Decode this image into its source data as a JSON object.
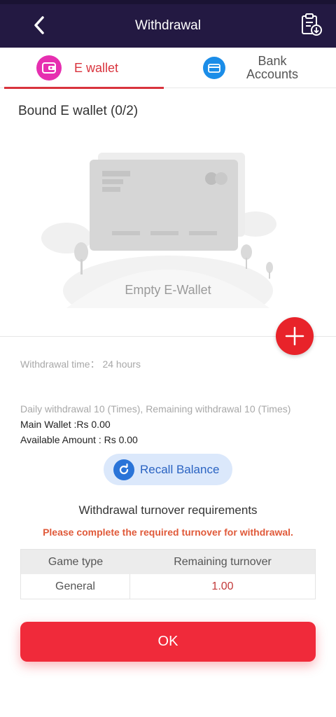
{
  "header": {
    "title": "Withdrawal"
  },
  "tabs": [
    {
      "label": "E wallet",
      "active": true,
      "icon": "wallet-icon",
      "color": "#e62fb0"
    },
    {
      "label": "Bank Accounts",
      "active": false,
      "icon": "bank-card-icon",
      "color": "#1b8de8"
    }
  ],
  "wallet": {
    "bound_label": "Bound E wallet (0/2)",
    "empty_text": "Empty E-Wallet"
  },
  "info": {
    "withdrawal_time": "Withdrawal time：  24 hours",
    "daily": "Daily withdrawal 10 (Times), Remaining withdrawal 10 (Times)",
    "main_wallet": "Main Wallet :Rs 0.00",
    "available": "Available Amount : Rs 0.00"
  },
  "recall_label": "Recall Balance",
  "turnover": {
    "title": "Withdrawal turnover requirements",
    "warning": "Please complete the required turnover for withdrawal.",
    "columns": [
      "Game type",
      "Remaining turnover"
    ],
    "rows": [
      {
        "game_type": "General",
        "remaining": "1.00"
      }
    ]
  },
  "ok_label": "OK",
  "colors": {
    "header_bg": "#231942",
    "accent_red": "#e8232a",
    "recall_blue": "#2a74d8"
  }
}
